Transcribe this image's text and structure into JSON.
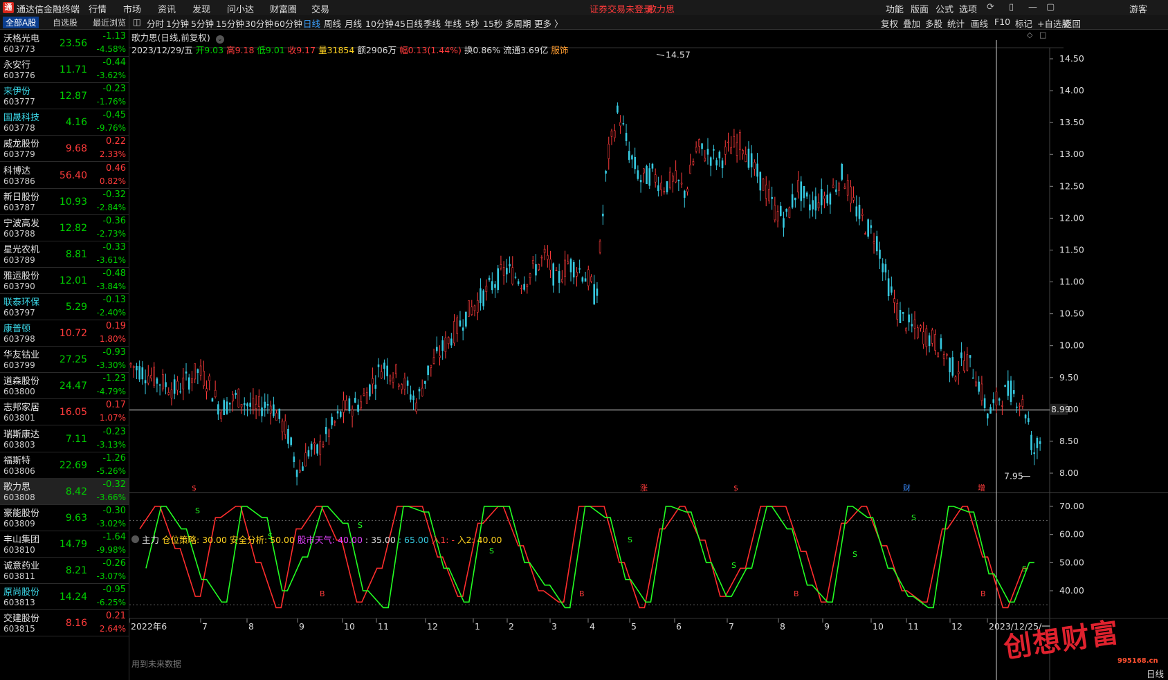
{
  "app": {
    "title": "通达信金融终端",
    "logo": "通"
  },
  "menu": [
    "行情",
    "市场",
    "资讯",
    "发现",
    "问小达",
    "财富圈",
    "交易"
  ],
  "status": {
    "login": "证券交易未登录",
    "stock": "歌力思"
  },
  "right_menu": [
    "功能",
    "版面",
    "公式",
    "选项"
  ],
  "guest": "游客",
  "sidebar_tabs": [
    "全部A股",
    "自选股",
    "最近浏览"
  ],
  "stocks": [
    {
      "name": "沃格光电",
      "code": "603773",
      "price": "23.56",
      "chg": "-1.13",
      "pct": "-4.58%",
      "dir": "dn",
      "cyan": false
    },
    {
      "name": "永安行",
      "code": "603776",
      "price": "11.71",
      "chg": "-0.44",
      "pct": "-3.62%",
      "dir": "dn",
      "cyan": false
    },
    {
      "name": "来伊份",
      "code": "603777",
      "price": "12.87",
      "chg": "-0.23",
      "pct": "-1.76%",
      "dir": "dn",
      "cyan": true
    },
    {
      "name": "国晟科技",
      "code": "603778",
      "price": "4.16",
      "chg": "-0.45",
      "pct": "-9.76%",
      "dir": "dn",
      "cyan": true
    },
    {
      "name": "威龙股份",
      "code": "603779",
      "price": "9.68",
      "chg": "0.22",
      "pct": "2.33%",
      "dir": "up",
      "cyan": false
    },
    {
      "name": "科博达",
      "code": "603786",
      "price": "56.40",
      "chg": "0.46",
      "pct": "0.82%",
      "dir": "up",
      "cyan": false
    },
    {
      "name": "新日股份",
      "code": "603787",
      "price": "10.93",
      "chg": "-0.32",
      "pct": "-2.84%",
      "dir": "dn",
      "cyan": false
    },
    {
      "name": "宁波高发",
      "code": "603788",
      "price": "12.82",
      "chg": "-0.36",
      "pct": "-2.73%",
      "dir": "dn",
      "cyan": false
    },
    {
      "name": "星光农机",
      "code": "603789",
      "price": "8.81",
      "chg": "-0.33",
      "pct": "-3.61%",
      "dir": "dn",
      "cyan": false
    },
    {
      "name": "雅运股份",
      "code": "603790",
      "price": "12.01",
      "chg": "-0.48",
      "pct": "-3.84%",
      "dir": "dn",
      "cyan": false
    },
    {
      "name": "联泰环保",
      "code": "603797",
      "price": "5.29",
      "chg": "-0.13",
      "pct": "-2.40%",
      "dir": "dn",
      "cyan": true
    },
    {
      "name": "康普顿",
      "code": "603798",
      "price": "10.72",
      "chg": "0.19",
      "pct": "1.80%",
      "dir": "up",
      "cyan": true
    },
    {
      "name": "华友钴业",
      "code": "603799",
      "price": "27.25",
      "chg": "-0.93",
      "pct": "-3.30%",
      "dir": "dn",
      "cyan": false
    },
    {
      "name": "道森股份",
      "code": "603800",
      "price": "24.47",
      "chg": "-1.23",
      "pct": "-4.79%",
      "dir": "dn",
      "cyan": false
    },
    {
      "name": "志邦家居",
      "code": "603801",
      "price": "16.05",
      "chg": "0.17",
      "pct": "1.07%",
      "dir": "up",
      "cyan": false
    },
    {
      "name": "瑞斯康达",
      "code": "603803",
      "price": "7.11",
      "chg": "-0.23",
      "pct": "-3.13%",
      "dir": "dn",
      "cyan": false
    },
    {
      "name": "福斯特",
      "code": "603806",
      "price": "22.69",
      "chg": "-1.26",
      "pct": "-5.26%",
      "dir": "dn",
      "cyan": false
    },
    {
      "name": "歌力思",
      "code": "603808",
      "price": "8.42",
      "chg": "-0.32",
      "pct": "-3.66%",
      "dir": "dn",
      "cyan": false,
      "selected": true
    },
    {
      "name": "豪能股份",
      "code": "603809",
      "price": "9.63",
      "chg": "-0.30",
      "pct": "-3.02%",
      "dir": "dn",
      "cyan": false
    },
    {
      "name": "丰山集团",
      "code": "603810",
      "price": "14.79",
      "chg": "-1.64",
      "pct": "-9.98%",
      "dir": "dn",
      "cyan": false
    },
    {
      "name": "诚意药业",
      "code": "603811",
      "price": "8.21",
      "chg": "-0.26",
      "pct": "-3.07%",
      "dir": "dn",
      "cyan": false
    },
    {
      "name": "原尚股份",
      "code": "603813",
      "price": "14.24",
      "chg": "-0.95",
      "pct": "-6.25%",
      "dir": "dn",
      "cyan": true
    },
    {
      "name": "交建股份",
      "code": "603815",
      "price": "8.16",
      "chg": "0.21",
      "pct": "2.64%",
      "dir": "up",
      "cyan": false
    }
  ],
  "periods": [
    "分时",
    "1分钟",
    "5分钟",
    "15分钟",
    "30分钟",
    "60分钟",
    "日线",
    "周线",
    "月线",
    "10分钟",
    "45日线",
    "季线",
    "年线",
    "5秒",
    "15秒",
    "多周期",
    "更多 〉"
  ],
  "active_period": "日线",
  "tools": [
    "复权",
    "叠加",
    "多股",
    "统计",
    "画线",
    "F10",
    "标记",
    "+自选股",
    "返回"
  ],
  "chart_title": "歌力思(日线,前复权)",
  "info": {
    "date": "2023/12/29/五",
    "open": "开9.03",
    "high": "高9.18",
    "low": "低9.01",
    "close": "收9.17",
    "volume": "量31854",
    "amount": "额2906万",
    "range": "幅0.13(1.44%)",
    "turnover": "换0.86%",
    "float": "流通3.69亿",
    "sector": "服饰"
  },
  "indicator_legend": {
    "name": "主力",
    "a": "仓位策略: 30.00",
    "b": "安全分析: 50.00",
    "c": "股市天气: 40.00",
    "d": ": 35.00",
    "e": ": 65.00",
    "f": "入1: -",
    "g": "入2: 40.00"
  },
  "future_note": "用到未来数据",
  "watermark": "创想财富",
  "watermark_site": "995168.cn",
  "bottom_right": "日线",
  "colors": {
    "up": "#ff3b3b",
    "down": "#36c9e0",
    "green": "#00d000",
    "grid": "#333333"
  },
  "chart_data": {
    "type": "candlestick",
    "price_axis": [
      "14.50",
      "14.00",
      "13.50",
      "13.00",
      "12.50",
      "12.00",
      "11.50",
      "11.00",
      "10.50",
      "10.00",
      "9.50",
      "9.00",
      "8.50",
      "8.00"
    ],
    "ylim": [
      7.95,
      14.57
    ],
    "max_label": "14.57",
    "min_label": "7.95",
    "crosshair_value": "8.99",
    "indicator_axis": [
      "70.00",
      "60.00",
      "50.00",
      "40.00"
    ],
    "indicator_ylim": [
      30,
      70
    ],
    "x_labels": [
      "2022年6",
      "7",
      "8",
      "9",
      "10",
      "11",
      "12",
      "1",
      "2",
      "3",
      "4",
      "5",
      "6",
      "7",
      "8",
      "9",
      "10",
      "11",
      "12",
      "2023/12/25/一"
    ],
    "event_markers": [
      "$",
      "涨",
      "$",
      "财",
      "增"
    ],
    "trend_points": [
      [
        0,
        9.7
      ],
      [
        20,
        9.5
      ],
      [
        40,
        9.3
      ],
      [
        60,
        9.6
      ],
      [
        70,
        9.4
      ],
      [
        80,
        9.0
      ],
      [
        95,
        9.2
      ],
      [
        110,
        9.0
      ],
      [
        125,
        9.1
      ],
      [
        140,
        8.6
      ],
      [
        150,
        8.0
      ],
      [
        160,
        8.4
      ],
      [
        165,
        8.3
      ],
      [
        175,
        8.6
      ],
      [
        190,
        9.0
      ],
      [
        205,
        9.1
      ],
      [
        215,
        9.4
      ],
      [
        225,
        9.7
      ],
      [
        240,
        9.5
      ],
      [
        255,
        9.1
      ],
      [
        265,
        9.6
      ],
      [
        280,
        10.0
      ],
      [
        300,
        10.5
      ],
      [
        320,
        10.9
      ],
      [
        335,
        11.2
      ],
      [
        350,
        11.0
      ],
      [
        360,
        11.2
      ],
      [
        370,
        11.4
      ],
      [
        380,
        11.0
      ],
      [
        390,
        11.3
      ],
      [
        400,
        11.2
      ],
      [
        410,
        11.0
      ],
      [
        415,
        10.7
      ],
      [
        425,
        12.9
      ],
      [
        435,
        13.7
      ],
      [
        445,
        13.0
      ],
      [
        455,
        12.6
      ],
      [
        465,
        12.7
      ],
      [
        475,
        12.5
      ],
      [
        485,
        12.6
      ],
      [
        495,
        12.4
      ],
      [
        505,
        13.1
      ],
      [
        515,
        13.0
      ],
      [
        525,
        12.9
      ],
      [
        535,
        13.1
      ],
      [
        545,
        13.2
      ],
      [
        555,
        12.8
      ],
      [
        565,
        12.5
      ],
      [
        575,
        12.1
      ],
      [
        585,
        12.0
      ],
      [
        595,
        12.5
      ],
      [
        605,
        12.2
      ],
      [
        615,
        12.3
      ],
      [
        625,
        12.4
      ],
      [
        635,
        12.7
      ],
      [
        645,
        12.2
      ],
      [
        655,
        11.9
      ],
      [
        665,
        11.7
      ],
      [
        675,
        11.0
      ],
      [
        685,
        10.5
      ],
      [
        695,
        10.3
      ],
      [
        705,
        10.2
      ],
      [
        715,
        10.1
      ],
      [
        725,
        9.9
      ],
      [
        735,
        9.6
      ],
      [
        745,
        9.8
      ],
      [
        755,
        9.5
      ],
      [
        765,
        8.9
      ],
      [
        775,
        9.2
      ],
      [
        785,
        9.3
      ],
      [
        795,
        9.1
      ],
      [
        800,
        8.9
      ],
      [
        805,
        8.3
      ],
      [
        810,
        8.5
      ]
    ],
    "indicator_series": [
      {
        "name": "red",
        "values": [
          62,
          70,
          55,
          38,
          66,
          70,
          50,
          34,
          62,
          70,
          58,
          36,
          48,
          70,
          70,
          52,
          38,
          64,
          70,
          56,
          40,
          36,
          70,
          70,
          50,
          34,
          62,
          70,
          58,
          38,
          48,
          70,
          70,
          54,
          36,
          64,
          70,
          56,
          40,
          36,
          62,
          70,
          52,
          34,
          48
        ]
      },
      {
        "name": "green",
        "values": [
          48,
          70,
          62,
          44,
          36,
          70,
          66,
          40,
          52,
          70,
          64,
          40,
          34,
          70,
          68,
          48,
          36,
          70,
          70,
          50,
          42,
          34,
          70,
          66,
          44,
          36,
          70,
          68,
          50,
          38,
          48,
          70,
          62,
          42,
          36,
          70,
          66,
          48,
          38,
          34,
          70,
          68,
          46,
          36,
          50
        ]
      }
    ]
  }
}
